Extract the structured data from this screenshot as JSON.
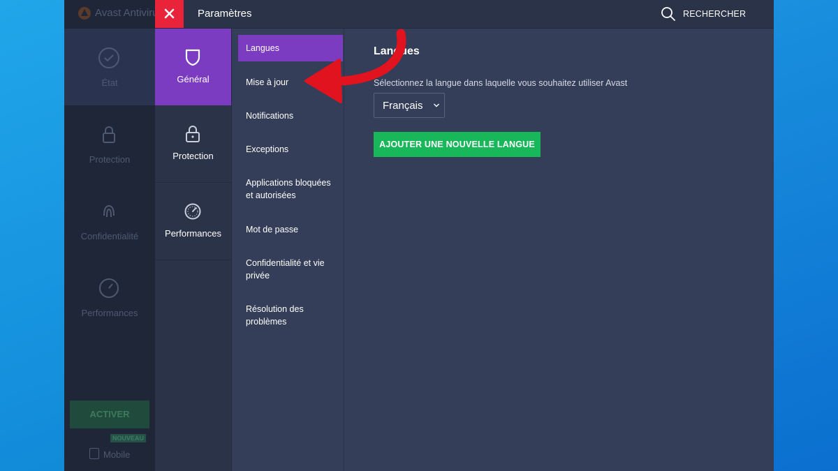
{
  "background_app": {
    "title": "Avast Antivirus",
    "nav": [
      {
        "label": "État",
        "icon": "check-circle-icon"
      },
      {
        "label": "Protection",
        "icon": "lock-icon"
      },
      {
        "label": "Confidentialité",
        "icon": "fingerprint-icon"
      },
      {
        "label": "Performances",
        "icon": "gauge-icon"
      }
    ],
    "activate_label": "ACTIVER",
    "new_badge": "NOUVEAU",
    "mobile_label": "Mobile"
  },
  "settings": {
    "title": "Paramètres",
    "search_label": "RECHERCHER",
    "categories": [
      {
        "label": "Général",
        "icon": "shield-icon",
        "active": true
      },
      {
        "label": "Protection",
        "icon": "lock-icon",
        "active": false
      },
      {
        "label": "Performances",
        "icon": "gauge-icon",
        "active": false
      }
    ],
    "subnav": [
      "Langues",
      "Mise à jour",
      "Notifications",
      "Exceptions",
      "Applications bloquées et autorisées",
      "Mot de passe",
      "Confidentialité et vie privée",
      "Résolution des problèmes"
    ],
    "content": {
      "title": "Langues",
      "description": "Sélectionnez la langue dans laquelle vous souhaitez utiliser Avast",
      "selected_language": "Français",
      "add_button": "AJOUTER UNE NOUVELLE LANGUE"
    }
  },
  "colors": {
    "accent_purple": "#7b3cc1",
    "close_red": "#e8233a",
    "action_green": "#18b75a",
    "annotation_arrow": "#e0131e"
  }
}
